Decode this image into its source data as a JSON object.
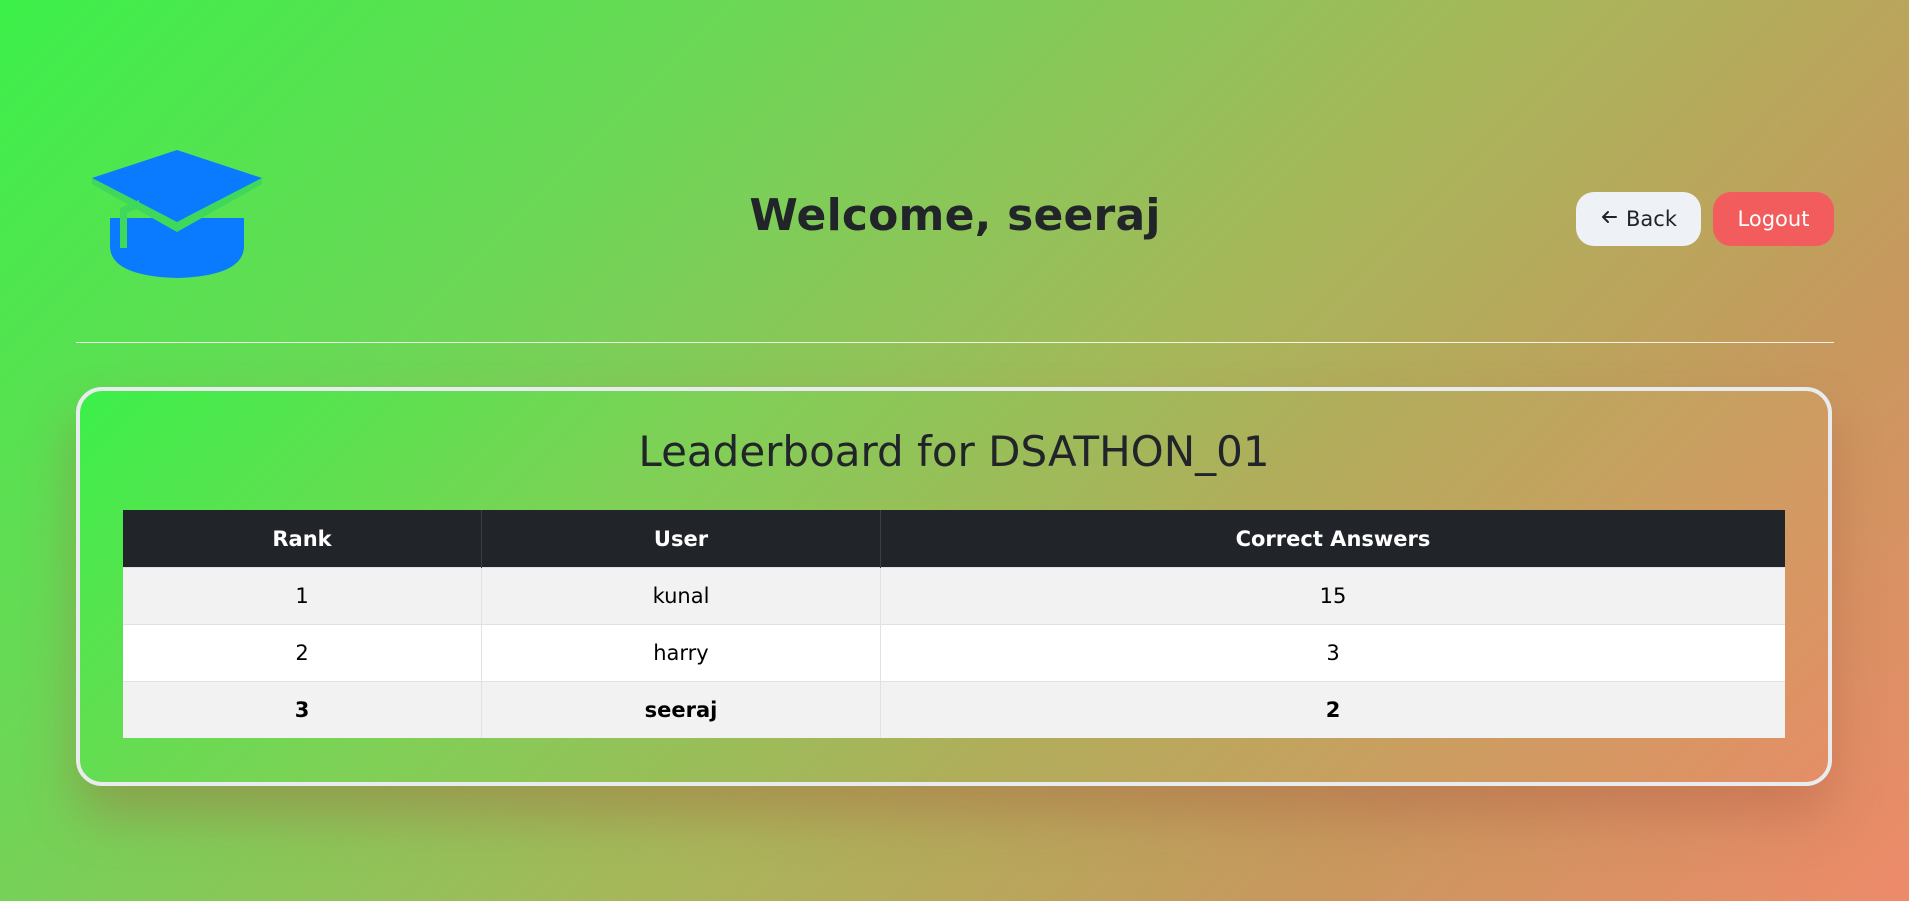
{
  "header": {
    "welcome": "Welcome, seeraj",
    "logo_icon": "graduation-cap-icon",
    "back_icon": "arrow-left-icon",
    "back_label": "Back",
    "logout_label": "Logout"
  },
  "leaderboard": {
    "title": "Leaderboard for DSATHON_01",
    "columns": [
      "Rank",
      "User",
      "Correct Answers"
    ],
    "rows": [
      {
        "rank": "1",
        "user": "kunal",
        "correct": "15"
      },
      {
        "rank": "2",
        "user": "harry",
        "correct": "3"
      },
      {
        "rank": "3",
        "user": "seeraj",
        "correct": "2"
      }
    ],
    "highlighted_user": "seeraj"
  },
  "colors": {
    "logo": "#0a7bff",
    "logout": "#f25c5c",
    "back": "#eef2f7",
    "table_header": "#212529"
  }
}
